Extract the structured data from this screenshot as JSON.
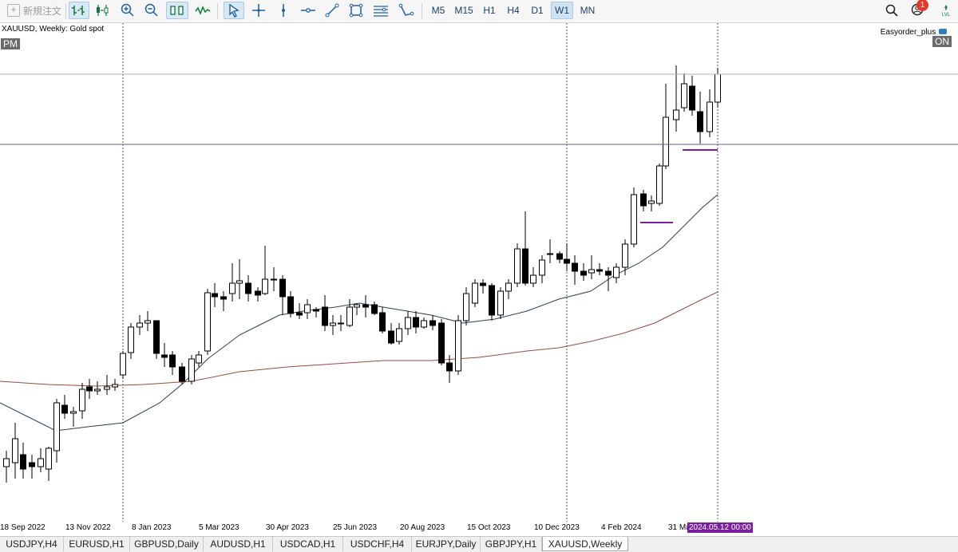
{
  "toolbar": {
    "new_order_label": "新規注文",
    "timeframes": [
      "M5",
      "M15",
      "H1",
      "H4",
      "D1",
      "W1",
      "MN"
    ],
    "active_timeframe": "W1",
    "notification_count": "1",
    "tools": [
      "bar-chart-icon",
      "candlestick-icon",
      "zoom-in-icon",
      "zoom-out-icon",
      "volume-bars-icon",
      "indicator-icon",
      "cursor-icon",
      "crosshair-icon",
      "vertical-line-icon",
      "horizontal-line-icon",
      "trend-line-icon",
      "rectangle-icon",
      "fibonacci-icon",
      "shapes-icon"
    ]
  },
  "chart": {
    "symbol_info": "XAUUSD, Weekly:  Gold spot",
    "session_badge": "PM",
    "ea_name": "Easyorder_plus",
    "ea_status": "ON",
    "colors": {
      "bull_body": "#ffffff",
      "bear_body": "#000000",
      "ma_fast": "#2c3e55",
      "ma_slow": "#9c4a3c",
      "hline": "#6a5a8c",
      "level": "#7b1fa2",
      "cursor_time_bg": "#7b1fa2"
    }
  },
  "time_axis": {
    "labels": [
      "18 Sep 2022",
      "13 Nov 2022",
      "8 Jan 2023",
      "5 Mar 2023",
      "30 Apr 2023",
      "25 Jun 2023",
      "20 Aug 2023",
      "15 Oct 2023",
      "10 Dec 2023",
      "4 Feb 2024",
      "31 Ma"
    ],
    "cursor_time": "2024.05.12 00:00"
  },
  "tabs": [
    "USDJPY,H4",
    "EURUSD,H1",
    "GBPUSD,Daily",
    "AUDUSD,H1",
    "USDCAD,H1",
    "USDCHF,H4",
    "EURJPY,Daily",
    "GBPJPY,H1",
    "XAUUSD,Weekly"
  ],
  "active_tab": "XAUUSD,Weekly"
}
